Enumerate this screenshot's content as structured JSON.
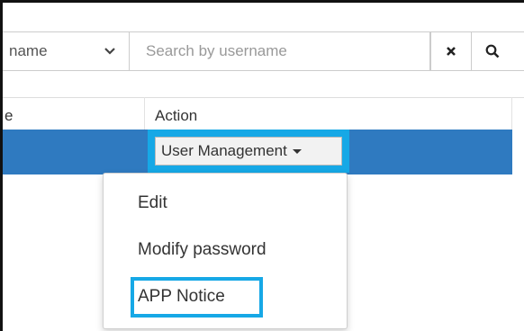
{
  "filter": {
    "selected_value": "name",
    "chevron_icon": "chevron-down-icon"
  },
  "search": {
    "placeholder": "Search by username",
    "value": ""
  },
  "buttons": {
    "clear_icon": "close-icon",
    "search_icon": "search-icon"
  },
  "table": {
    "headers": [
      "e",
      "Action"
    ]
  },
  "action_menu": {
    "button_label": "User Management",
    "items": [
      "Edit",
      "Modify password",
      "APP Notice"
    ],
    "highlighted": "APP Notice"
  },
  "colors": {
    "selected_row": "#2f7ac0",
    "highlight_outline": "#16a8e6"
  }
}
